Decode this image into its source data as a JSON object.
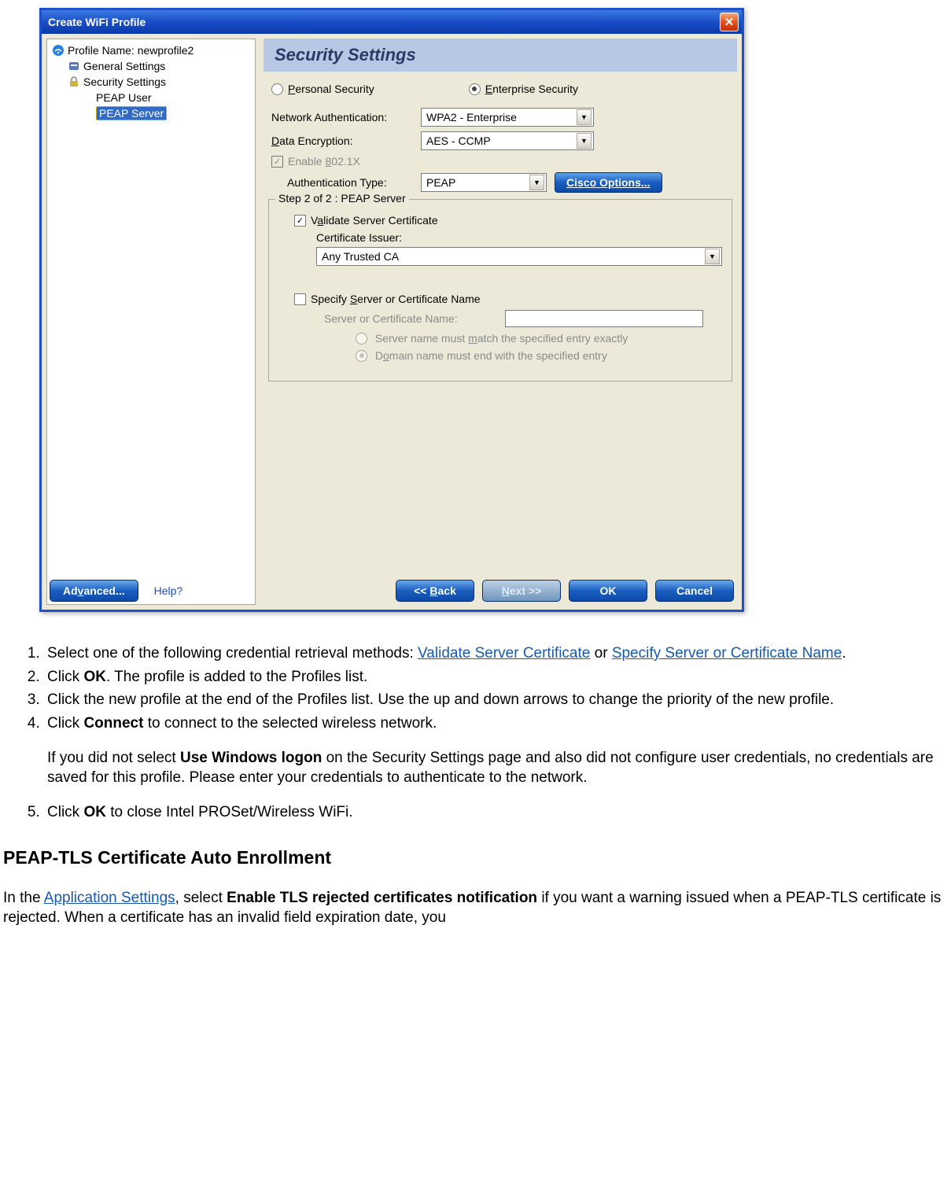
{
  "dialog": {
    "title": "Create WiFi Profile",
    "tree": {
      "profile_label": "Profile Name:",
      "profile_name": "newprofile2",
      "general": "General Settings",
      "security": "Security Settings",
      "peap_user": "PEAP User",
      "peap_server": "PEAP Server"
    },
    "header": "Security Settings",
    "radios": {
      "personal": "Personal Security",
      "enterprise": "Enterprise Security"
    },
    "labels": {
      "net_auth": "Network Authentication:",
      "data_enc": "Data Encryption:",
      "enable_8021x": "Enable 802.1X",
      "auth_type": "Authentication Type:"
    },
    "dropdowns": {
      "net_auth": "WPA2 - Enterprise",
      "data_enc": "AES - CCMP",
      "auth_type": "PEAP",
      "cert_issuer": "Any Trusted CA"
    },
    "cisco_btn": "Cisco Options...",
    "groupbox": {
      "legend": "Step 2 of 2 : PEAP Server",
      "validate": "Validate Server Certificate",
      "issuer_label": "Certificate Issuer:",
      "specify": "Specify Server or Certificate Name",
      "server_name_label": "Server or Certificate Name:",
      "match_exact": "Server name must match the specified entry exactly",
      "domain_end": "Domain name must end with the specified entry"
    },
    "buttons": {
      "advanced": "Advanced...",
      "help": "Help?",
      "back": "<< Back",
      "next": "Next >>",
      "ok": "OK",
      "cancel": "Cancel"
    }
  },
  "doc": {
    "li1_a": "Select one of the following credential retrieval methods: ",
    "li1_link1": "Validate Server Certificate",
    "li1_b": " or ",
    "li1_link2": "Specify Server or Certificate Name",
    "li1_c": ".",
    "li2_a": "Click ",
    "li2_bold": "OK",
    "li2_b": ". The profile is added to the Profiles list.",
    "li3": "Click the new profile at the end of the Profiles list. Use the up and down arrows to change the priority of the new profile.",
    "li4_a": "Click ",
    "li4_bold": "Connect",
    "li4_b": " to connect to the selected wireless network.",
    "li4_para_a": "If you did not select ",
    "li4_para_bold": "Use Windows logon",
    "li4_para_b": " on the Security Settings page and also did not configure user credentials, no credentials are saved for this profile. Please enter your credentials to authenticate to the network.",
    "li5_a": "Click ",
    "li5_bold": "OK",
    "li5_b": " to close Intel PROSet/Wireless WiFi.",
    "h3": "PEAP-TLS Certificate Auto Enrollment",
    "final_a": "In the ",
    "final_link": "Application Settings",
    "final_b": ", select ",
    "final_bold": "Enable TLS rejected certificates notification",
    "final_c": " if you want a warning issued when a PEAP-TLS certificate is rejected. When a certificate has an invalid field expiration date, you"
  }
}
